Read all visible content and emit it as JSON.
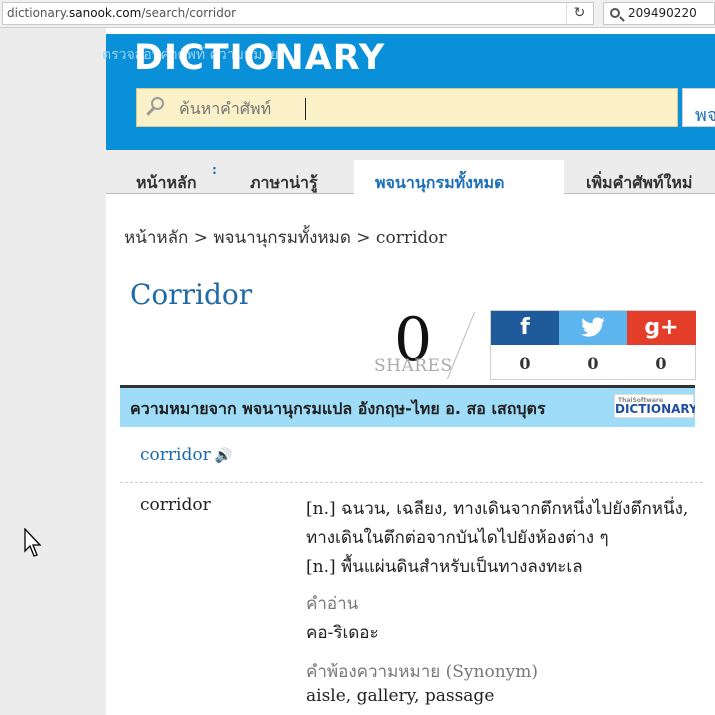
{
  "browser": {
    "url_prefix": "dictionary.",
    "url_domain": "sanook.com",
    "url_path": "/search/corridor",
    "refresh_icon": "refresh-icon",
    "search_value": "209490220"
  },
  "header": {
    "subtitle": "ตรวจสอบคำศัพท์ ความหมาย",
    "logo": "DICTIONARY",
    "search_placeholder": "ค้นหาคำศัพท์",
    "search_button": "พจ"
  },
  "nav": {
    "items": [
      {
        "label": "หน้าหลัก"
      },
      {
        "label": "ภาษาน่ารู้"
      },
      {
        "label": "พจนานุกรมทั้งหมด"
      },
      {
        "label": "เพิ่มคำศัพท์ใหม่"
      }
    ],
    "dot": ":"
  },
  "breadcrumb": "หน้าหลัก > พจนานุกรมทั้งหมด > corridor",
  "word": {
    "title": "Corridor",
    "headword": "corridor",
    "entry": "corridor"
  },
  "share": {
    "count": "0",
    "label": "SHARES",
    "facebook_glyph": "f",
    "twitter_icon": "twitter-icon",
    "google_glyph": "g+",
    "facebook_count": "0",
    "twitter_count": "0",
    "google_count": "0"
  },
  "meaning_source": {
    "title": "ความหมายจาก พจนานุกรมแปล อังกฤษ-ไทย อ. สอ เสถบุตร",
    "logo_small": "ThaiSoftware",
    "logo": "DICTIONARY"
  },
  "definitions": [
    "[n.] ฉนวน, เฉลียง, ทางเดินจากตึกหนึ่งไปยังตึกหนึ่ง, ทางเดินในตึกต่อจากบันไดไปยังห้องต่าง ๆ",
    "[n.] พื้นแผ่นดินสำหรับเป็นทางลงทะเล"
  ],
  "pronunciation": {
    "label": "คำอ่าน",
    "value": "คอ-ริเดอะ"
  },
  "synonym": {
    "label": "คำพ้องความหมาย (Synonym)",
    "value": "aisle, gallery, passage"
  },
  "colors": {
    "header_blue": "#0a90d8",
    "title_blue": "#1e6aa6",
    "facebook": "#1f5b9b",
    "twitter": "#5cb5ee",
    "google": "#e23e2a",
    "meaning_bar": "#9fdcf7"
  }
}
